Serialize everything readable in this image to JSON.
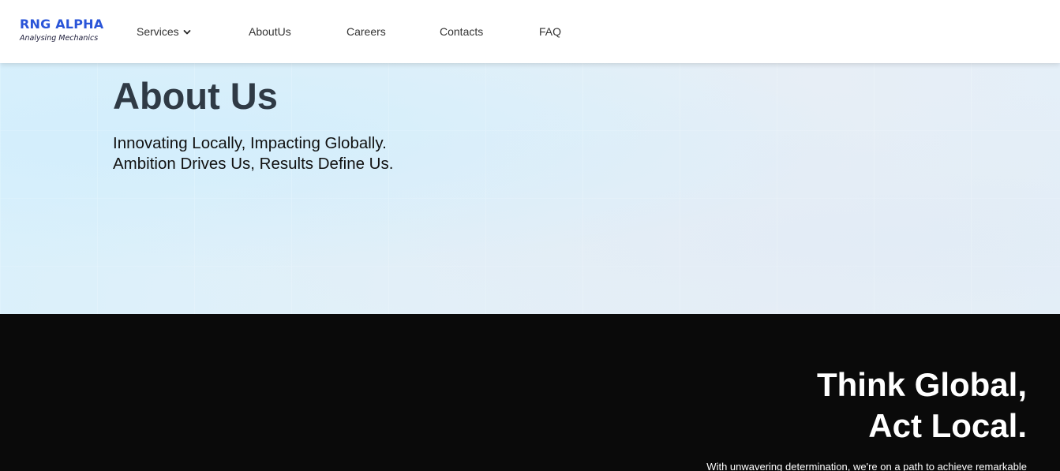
{
  "header": {
    "logo": {
      "name": "RNG ALPHA",
      "tagline": "Analysing Mechanics"
    },
    "nav": [
      {
        "label": "Services",
        "icon": "chevron-down-icon"
      },
      {
        "label": "AboutUs"
      },
      {
        "label": "Careers"
      },
      {
        "label": "Contacts"
      },
      {
        "label": "FAQ"
      }
    ]
  },
  "hero": {
    "title": "About Us",
    "lines": [
      "Innovating Locally, Impacting Globally.",
      "Ambition Drives Us, Results Define Us."
    ]
  },
  "dark_section": {
    "heading_lines": [
      "Think Global,",
      "Act Local."
    ],
    "body": "With unwavering determination, we're on a path to achieve remarkable"
  },
  "colors": {
    "brand": "#2a55d8",
    "heading": "#2f3a45",
    "dark_bg": "#0a0a0a"
  }
}
